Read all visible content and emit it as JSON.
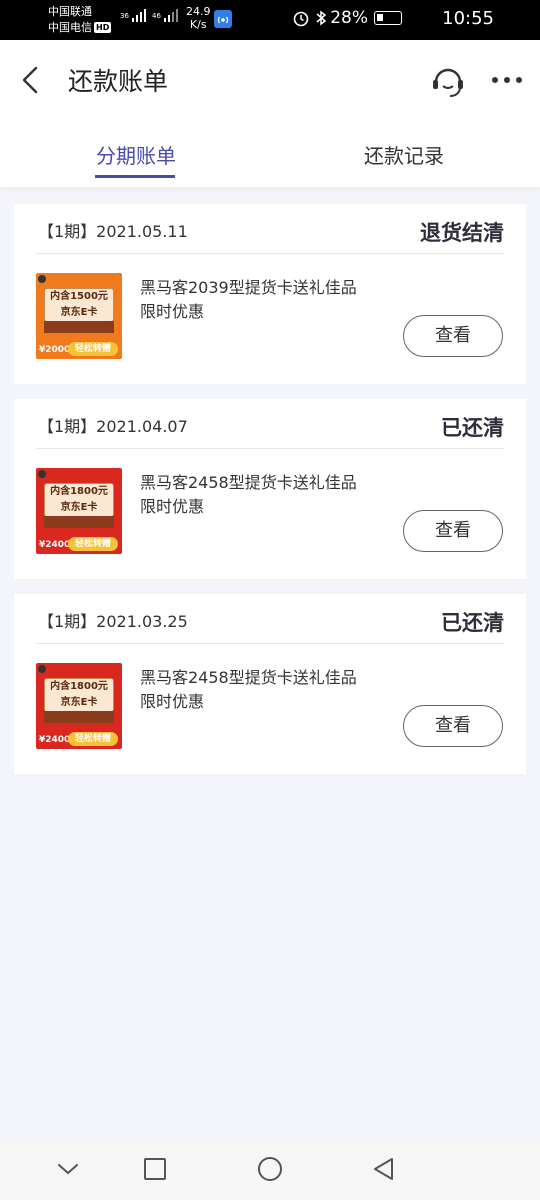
{
  "status_bar": {
    "carrier1": "中国联通",
    "carrier2": "中国电信",
    "hd": "HD",
    "signal1": "36",
    "signal2": "46",
    "speed_value": "24.9",
    "speed_unit": "K/s",
    "battery": "28%",
    "time": "10:55"
  },
  "header": {
    "title": "还款账单",
    "back_icon": "chevron-left-icon",
    "service_icon": "customer-service-icon",
    "more_icon": "more-dots-icon"
  },
  "tabs": [
    {
      "label": "分期账单",
      "active": true
    },
    {
      "label": "还款记录",
      "active": false
    }
  ],
  "bills": [
    {
      "period": "【1期】2021.05.11",
      "status": "退货结清",
      "product_title": "黑马客2039型提货卡送礼佳品",
      "product_subtitle": "限时优惠",
      "thumb_line1": "内含1500元",
      "thumb_line2": "京东E卡",
      "thumb_price": "¥2000",
      "thumb_slogan": "轻松转赠",
      "thumb_color": "#f07a1e",
      "button": "查看"
    },
    {
      "period": "【1期】2021.04.07",
      "status": "已还清",
      "product_title": "黑马客2458型提货卡送礼佳品",
      "product_subtitle": "限时优惠",
      "thumb_line1": "内含1800元",
      "thumb_line2": "京东E卡",
      "thumb_price": "¥2400",
      "thumb_slogan": "轻松转赠",
      "thumb_color": "#d8281f",
      "button": "查看"
    },
    {
      "period": "【1期】2021.03.25",
      "status": "已还清",
      "product_title": "黑马客2458型提货卡送礼佳品",
      "product_subtitle": "限时优惠",
      "thumb_line1": "内含1800元",
      "thumb_line2": "京东E卡",
      "thumb_price": "¥2400",
      "thumb_slogan": "轻松转赠",
      "thumb_color": "#d8281f",
      "button": "查看"
    }
  ],
  "nav": {
    "icons": [
      "chevron-down-icon",
      "square-recent-icon",
      "circle-home-icon",
      "triangle-back-icon"
    ]
  },
  "colors": {
    "accent": "#4a4ab0",
    "background": "#f4f5fa",
    "status_text": "#2e2e3a"
  }
}
